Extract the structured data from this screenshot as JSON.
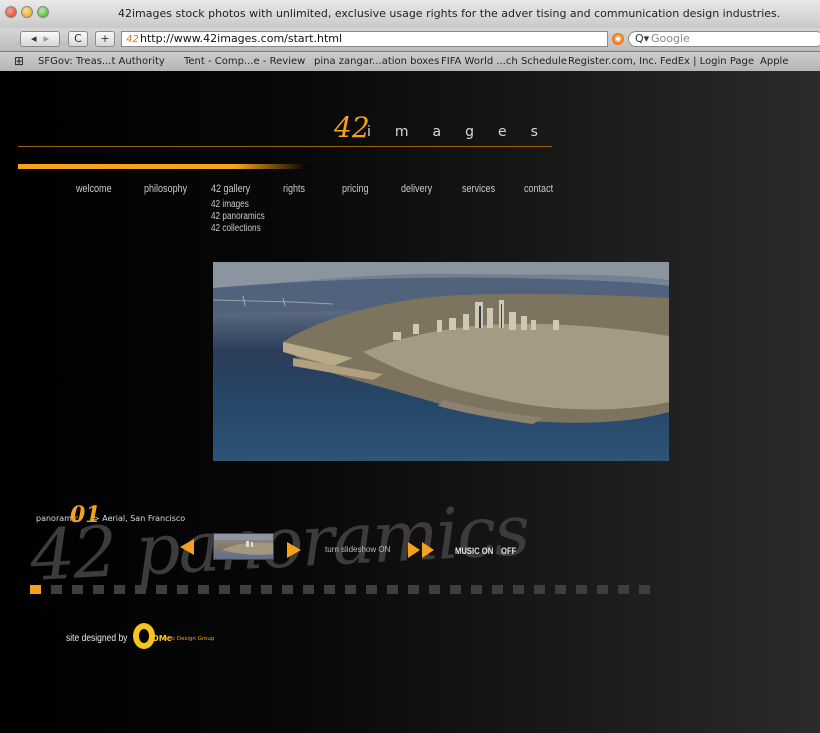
{
  "window": {
    "title": "42images stock photos with unlimited, exclusive usage rights for the adver tising and communication design industries."
  },
  "toolbar": {
    "back_icon": "back-arrow-icon",
    "forward_icon": "forward-arrow-icon",
    "reload_label": "C",
    "add_label": "+",
    "url": "http://www.42images.com/start.html",
    "search_placeholder": "Google"
  },
  "bookmarks": [
    "SFGov: Treas...t Authority",
    "Tent - Comp...e - Review",
    "pina zangar...ation boxes",
    "FIFA World ...ch Schedule",
    "Register.com, Inc.",
    "FedEx | Login Page",
    "Apple"
  ],
  "site": {
    "logo_number": "42",
    "logo_word": "images",
    "nav": [
      "welcome",
      "philosophy",
      "42 gallery",
      "rights",
      "pricing",
      "delivery",
      "services",
      "contact"
    ],
    "gallery_sub": [
      "42 images",
      "42 panoramics",
      "42 collections"
    ],
    "panoramic_label": "panoramic",
    "panoramic_number": "01",
    "panoramic_caption": "> Aerial, San Francisco",
    "watermark": "42 panoramics",
    "slideshow_label": "turn slideshow ON",
    "music_label": "MUSIC ON",
    "music_off": "OFF",
    "credit_prefix": "site designed by",
    "credit_brand": "OMc",
    "credit_name": "OMc Design Group",
    "pager_total": 30,
    "pager_active": 1
  },
  "colors": {
    "accent": "#f4a21c",
    "background": "#000000",
    "nav_text": "#c9c9c9"
  }
}
